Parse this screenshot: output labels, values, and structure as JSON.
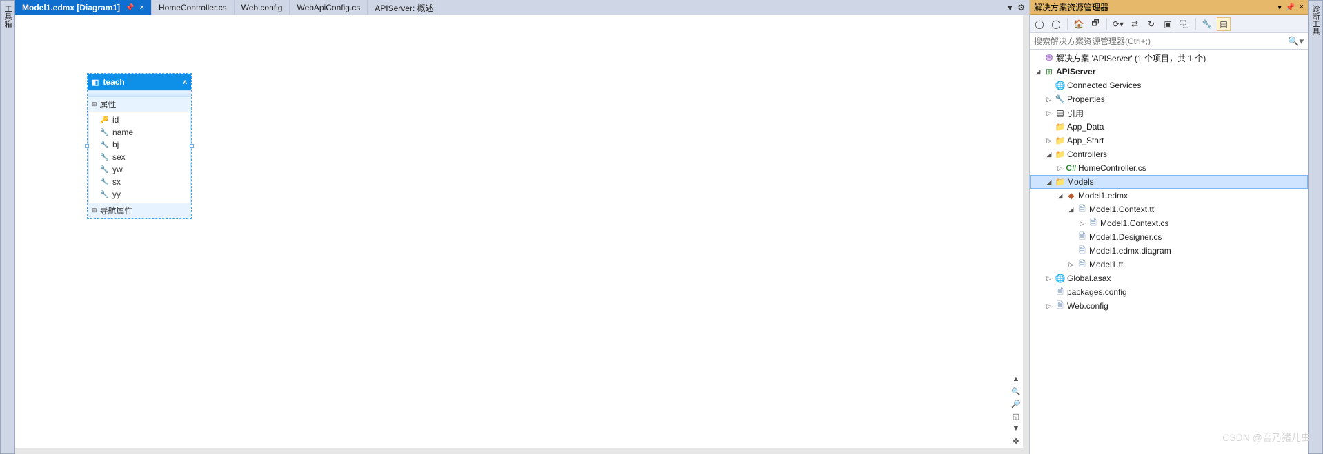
{
  "left_rail": {
    "label": "工具箱"
  },
  "right_rail": {
    "label": "诊断工具"
  },
  "tabs": [
    {
      "label": "Model1.edmx [Diagram1]",
      "active": true,
      "pinned": true,
      "closable": true
    },
    {
      "label": "HomeController.cs",
      "active": false
    },
    {
      "label": "Web.config",
      "active": false
    },
    {
      "label": "WebApiConfig.cs",
      "active": false
    },
    {
      "label": "APIServer: 概述",
      "active": false
    }
  ],
  "entity": {
    "name": "teach",
    "section_props": "属性",
    "section_nav": "导航属性",
    "props": [
      {
        "name": "id",
        "key": true
      },
      {
        "name": "name",
        "key": false
      },
      {
        "name": "bj",
        "key": false
      },
      {
        "name": "sex",
        "key": false
      },
      {
        "name": "yw",
        "key": false
      },
      {
        "name": "sx",
        "key": false
      },
      {
        "name": "yy",
        "key": false
      }
    ]
  },
  "explorer": {
    "title": "解决方案资源管理器",
    "search_placeholder": "搜索解决方案资源管理器(Ctrl+;)",
    "tree": {
      "solution": "解决方案 'APIServer' (1 个项目，共 1 个)",
      "project": "APIServer",
      "connected": "Connected Services",
      "properties": "Properties",
      "references": "引用",
      "appdata": "App_Data",
      "appstart": "App_Start",
      "controllers": "Controllers",
      "homectrl": "HomeController.cs",
      "models": "Models",
      "model1": "Model1.edmx",
      "contexttt": "Model1.Context.tt",
      "contextcs": "Model1.Context.cs",
      "designer": "Model1.Designer.cs",
      "diagram": "Model1.edmx.diagram",
      "model1tt": "Model1.tt",
      "global": "Global.asax",
      "packages": "packages.config",
      "webconfig": "Web.config"
    }
  },
  "watermark": "CSDN @吾乃猪儿虫"
}
